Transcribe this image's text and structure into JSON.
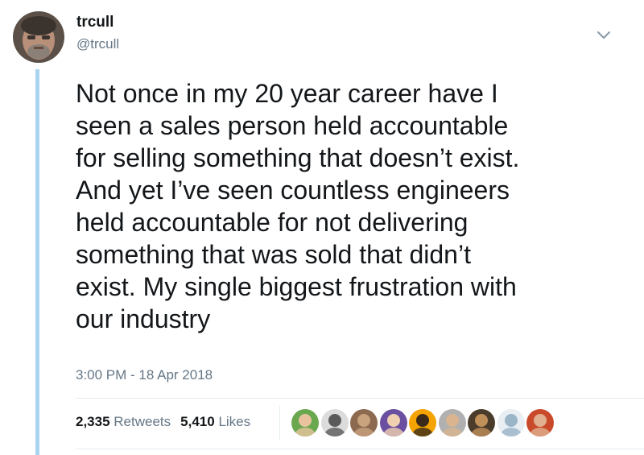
{
  "tweet": {
    "display_name": "trcull",
    "handle": "@trcull",
    "text": "Not once in my 20 year career have I\nseen a sales person held accountable\nfor selling something that doesn’t exist.\nAnd yet I’ve seen countless engineers\nheld accountable for not delivering\nsomething that was sold that didn’t\nexist. My single biggest frustration with\nour industry",
    "timestamp": "3:00 PM - 18 Apr 2018",
    "retweets_count": "2,335",
    "retweets_label": "Retweets",
    "likes_count": "5,410",
    "likes_label": "Likes"
  },
  "icons": {
    "menu": "chevron-down-icon",
    "avatar": "user-avatar"
  },
  "colors": {
    "text": "#14171a",
    "secondary_text": "#657786",
    "thread_line": "#a9d3ef",
    "divider": "#e6ecf0"
  },
  "likers": [
    {
      "bg": "#6aa84f",
      "face": "#e8c39e"
    },
    {
      "bg": "#dcdcdc",
      "face": "#5a5a5a"
    },
    {
      "bg": "#8c6a4f",
      "face": "#c9a27e"
    },
    {
      "bg": "#6b4fa0",
      "face": "#f0d0b0"
    },
    {
      "bg": "#f4a300",
      "face": "#3a2a1a"
    },
    {
      "bg": "#b0b0b0",
      "face": "#d9b48f"
    },
    {
      "bg": "#4a3b2a",
      "face": "#c0905a"
    },
    {
      "bg": "#e8eef2",
      "face": "#9ab4c8"
    },
    {
      "bg": "#c94a2a",
      "face": "#e0b090"
    }
  ]
}
